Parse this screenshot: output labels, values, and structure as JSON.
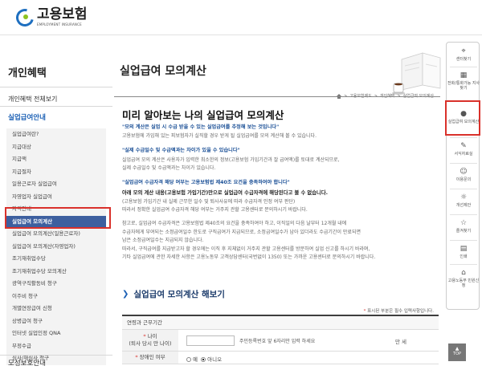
{
  "header": {
    "logo_title": "고용보험",
    "logo_sub": "EMPLOYMENT INSURANCE"
  },
  "lnb": {
    "title": "개인혜택",
    "all_label": "개인혜택 전체보기",
    "group_label": "실업급여안내",
    "items": [
      "실업급여란?",
      "지급대상",
      "지급액",
      "지급절차",
      "일용근로자 실업급여",
      "자영업자 실업급여",
      "자격안내",
      "실업급여 모의계산",
      "실업급여 모의계산(일용근로자)",
      "실업급여 모의계산(자영업자)",
      "조기재취업수당",
      "조기재취업수당 모의계산",
      "광역구직활동비 청구",
      "이주비 청구",
      "개별연장급여 신청",
      "상병급여 청구",
      "인터넷 실업인정 QNA",
      "부정수급",
      "심사/재심사 청구"
    ],
    "bottom_label": "모성보호안내"
  },
  "main": {
    "title": "실업급여 모의계산",
    "breadcrumb": [
      ">",
      "고용보험제도",
      ">",
      "개인혜택",
      ">",
      "실업급여 모의계산"
    ],
    "section_title": "미리 알아보는 나의 실업급여 모의계산",
    "p1_head": "\"모의 계산은 실업 시 수급 받을 수 있는 실업급여를 추정해 보는 것입니다\"",
    "p1_body": "고용보험에 가입해 있는 피보험자가 실직할 경우 받게 될 실업급여를 모의 계산해 볼 수 있습니다.",
    "p2_head": "\"실제 수급일수 및 수급액과는 차이가 있을 수 있습니다\"",
    "p2_body1": "실업급여 모의 계산은 사용자가 입력한 최소한의 정보(고용보험 가입기간과 잘 급여액)를 토대로 계산되므로,",
    "p2_body2": "실제 수급일수 및 수급액과는 차이가 있습니다.",
    "p3_head": "\"실업급여 수급자격 해당 여부는 고용보험법 제40조 요건을 충족하여야 합니다\"",
    "p3_dark": "아래 모의 계산 내용(고용보험 가입기간)만으로 실업급여 수급자격에 해당된다고 볼 수 없습니다.",
    "p3_body1": "(고용보험 가입기간 내 실제 근무한 일수 및 퇴사사유에 따라 수급자격 인정 여부 판단)",
    "p3_body2": "따라서 정확한 실업급여 수급자격 해당 여부는 거주지 관할 고용센터로 문의하시기 바랍니다.",
    "p4_body1": "참고로, 실업급여 수급자격은 고용보험법 제40조의 요건을 충족하여야 하고, 이직일의 다음 날부터 12개월 내에",
    "p4_body2": "수급자에게 부여되는 소정급여일수 한도로 구직급여가 지급되므로, 소정급여일수가 남아 있더라도 수급기간이 만료되면",
    "p4_body3": "남은 소정급여일수는 지급되지 않습니다.",
    "p4_body4": "따라서, 구직급여를 지급받고자 할 경우에는 이직 후 지체없이 거주지 관할 고용센터를 방문하여 실업 신고를 하시기 바라며,",
    "p4_body5": "기타 실업급여에 관한 자세한 사항은 고용노동부 고객상담센터(국번없이 1350) 또는 가까운 고용센터로 문의하시기 바랍니다.",
    "calc_title": "실업급여 모의계산 해보기",
    "req_note": "표시된 부분은 필수 입력사항입니다.",
    "form": {
      "group_label": "연령과 근무기간",
      "age_label": "나이",
      "age_sub": "(퇴사 당시 만 나이)",
      "age_hint": "주민등록번호 앞 6자리만 입력 하세요",
      "age_unit": "만 세",
      "disability_label": "장애인 여부",
      "opt_yes": "예",
      "opt_no": "아니오"
    }
  },
  "quick": {
    "items": [
      {
        "label": "센터찾기",
        "icon": "location-pin-icon"
      },
      {
        "label": "전화/통화가능 지사찾기",
        "icon": "map-icon"
      },
      {
        "label": "실업급여 모의계산",
        "icon": "person-icon"
      },
      {
        "label": "서식자료실",
        "icon": "document-icon"
      },
      {
        "label": "이용문의",
        "icon": "chat-icon"
      },
      {
        "label": "개선제안",
        "icon": "lightbulb-icon"
      },
      {
        "label": "즐겨찾기",
        "icon": "star-icon"
      },
      {
        "label": "인쇄",
        "icon": "printer-icon"
      },
      {
        "label": "고용노동부 민원신청",
        "icon": "building-icon"
      }
    ],
    "top_label": "TOP"
  },
  "colors": {
    "accent": "#3d5f9f",
    "highlight_box": "#d9312b",
    "heading_blue": "#1a4f96"
  }
}
